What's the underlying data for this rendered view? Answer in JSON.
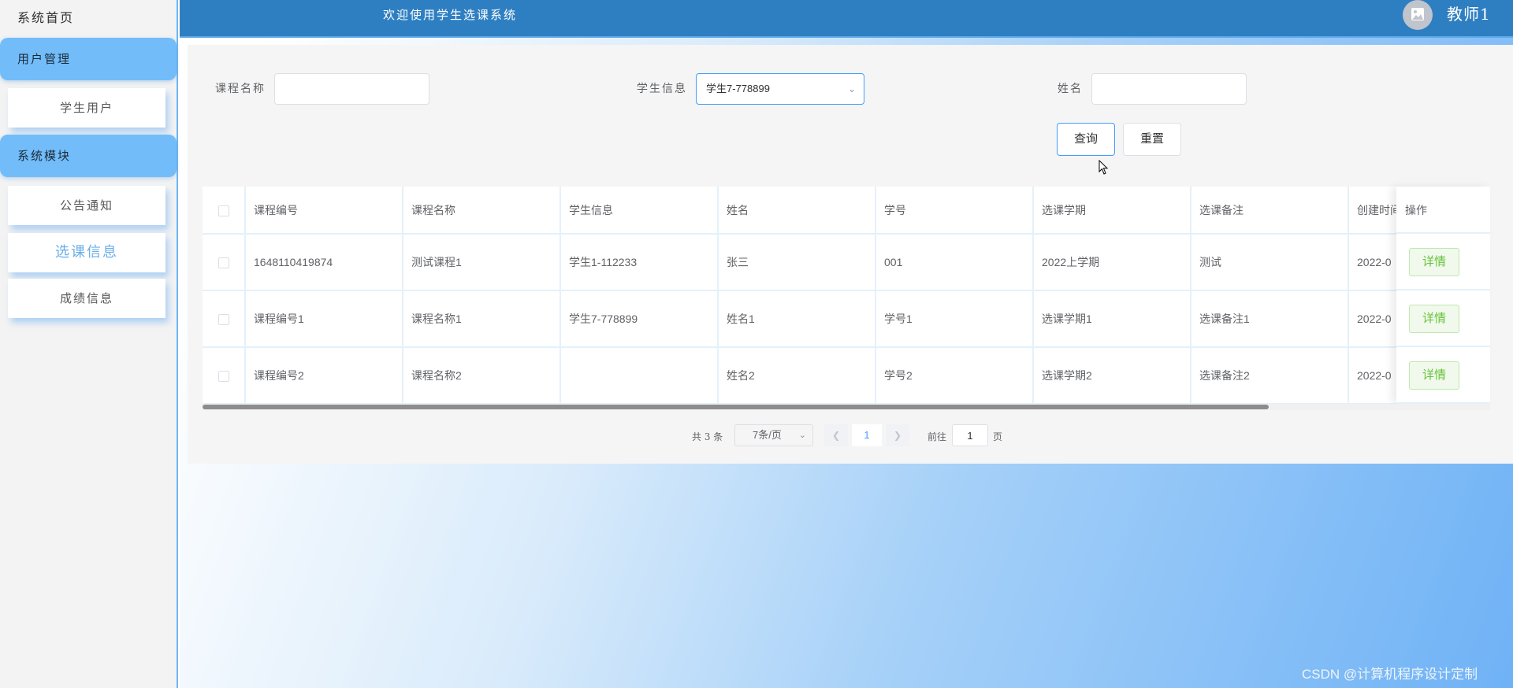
{
  "sidebar": {
    "home": "系统首页",
    "groups": [
      {
        "label": "用户管理",
        "items": [
          "学生用户"
        ]
      },
      {
        "label": "系统模块",
        "items": [
          "公告通知",
          "选课信息",
          "成绩信息"
        ]
      }
    ]
  },
  "header": {
    "title": "欢迎使用学生选课系统",
    "user": "教师1"
  },
  "search": {
    "course_name_label": "课程名称",
    "course_name_value": "",
    "student_info_label": "学生信息",
    "student_info_value": "学生7-778899",
    "name_label": "姓名",
    "name_value": "",
    "query_button": "查询",
    "reset_button": "重置"
  },
  "table": {
    "columns": [
      "课程编号",
      "课程名称",
      "学生信息",
      "姓名",
      "学号",
      "选课学期",
      "选课备注",
      "创建时间",
      "操作"
    ],
    "rows": [
      [
        "1648110419874",
        "测试课程1",
        "学生1-112233",
        "张三",
        "001",
        "2022上学期",
        "测试",
        "2022-0"
      ],
      [
        "课程编号1",
        "课程名称1",
        "学生7-778899",
        "姓名1",
        "学号1",
        "选课学期1",
        "选课备注1",
        "2022-0"
      ],
      [
        "课程编号2",
        "课程名称2",
        "",
        "姓名2",
        "学号2",
        "选课学期2",
        "选课备注2",
        "2022-0"
      ]
    ],
    "action_label": "详情"
  },
  "pagination": {
    "total": "共 3 条",
    "page_size": "7条/页",
    "current_page": "1",
    "goto_prefix": "前往",
    "goto_value": "1",
    "goto_suffix": "页"
  },
  "watermark": "CSDN @计算机程序设计定制",
  "colors": {
    "topbar": "#2e7fc2",
    "sidebar_group": "#72bdf9",
    "accent": "#409eff",
    "detail_green": "#67c23a"
  }
}
